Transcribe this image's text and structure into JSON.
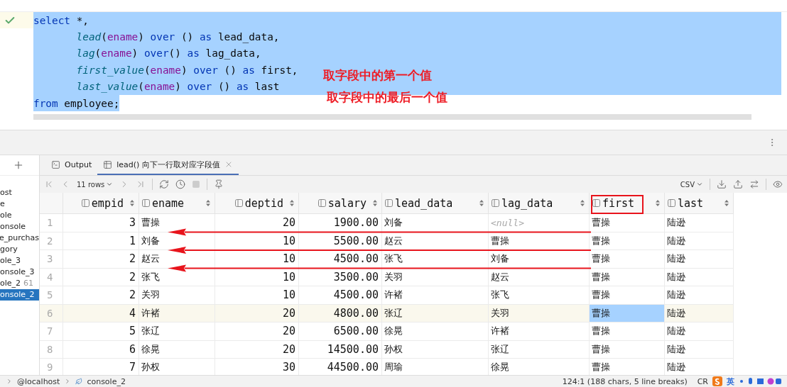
{
  "editor": {
    "executed": true,
    "lines": [
      {
        "selected": true,
        "indent": false,
        "tokens": [
          {
            "text": "select",
            "kind": "keyword"
          },
          {
            "text": " *,",
            "kind": "plain"
          }
        ]
      },
      {
        "selected": true,
        "indent": true,
        "tokens": [
          {
            "text": "lead",
            "kind": "function"
          },
          {
            "text": "(",
            "kind": "plain"
          },
          {
            "text": "ename",
            "kind": "field"
          },
          {
            "text": ") ",
            "kind": "plain"
          },
          {
            "text": "over",
            "kind": "keyword"
          },
          {
            "text": " () ",
            "kind": "plain"
          },
          {
            "text": "as",
            "kind": "keyword"
          },
          {
            "text": " lead_data,",
            "kind": "plain"
          }
        ]
      },
      {
        "selected": true,
        "indent": true,
        "tokens": [
          {
            "text": "lag",
            "kind": "function"
          },
          {
            "text": "(",
            "kind": "plain"
          },
          {
            "text": "ename",
            "kind": "field"
          },
          {
            "text": ") ",
            "kind": "plain"
          },
          {
            "text": "over",
            "kind": "keyword"
          },
          {
            "text": "() ",
            "kind": "plain"
          },
          {
            "text": "as",
            "kind": "keyword"
          },
          {
            "text": " lag_data,",
            "kind": "plain"
          }
        ]
      },
      {
        "selected": true,
        "indent": true,
        "tokens": [
          {
            "text": "first_value",
            "kind": "function"
          },
          {
            "text": "(",
            "kind": "plain"
          },
          {
            "text": "ename",
            "kind": "field"
          },
          {
            "text": ") ",
            "kind": "plain"
          },
          {
            "text": "over",
            "kind": "keyword"
          },
          {
            "text": " () ",
            "kind": "plain"
          },
          {
            "text": "as",
            "kind": "keyword"
          },
          {
            "text": " first,",
            "kind": "plain"
          }
        ]
      },
      {
        "selected": true,
        "indent": true,
        "tokens": [
          {
            "text": "last_value",
            "kind": "function"
          },
          {
            "text": "(",
            "kind": "plain"
          },
          {
            "text": "ename",
            "kind": "field"
          },
          {
            "text": ") ",
            "kind": "plain"
          },
          {
            "text": "over",
            "kind": "keyword"
          },
          {
            "text": " () ",
            "kind": "plain"
          },
          {
            "text": "as",
            "kind": "keyword"
          },
          {
            "text": " last",
            "kind": "plain"
          }
        ]
      },
      {
        "selected": true,
        "indent": false,
        "tokens": [
          {
            "text": "from",
            "kind": "keyword"
          },
          {
            "text": " employee;",
            "kind": "plain"
          }
        ]
      }
    ],
    "annotations": [
      "取字段中的第一个值",
      "取字段中的最后一个值"
    ]
  },
  "sidebar": {
    "items": [
      {
        "label": "ost",
        "selected": false
      },
      {
        "label": "e",
        "selected": false
      },
      {
        "label": "ole",
        "selected": false
      },
      {
        "label": "onsole",
        "selected": false
      },
      {
        "label": "e_purchas",
        "selected": false
      },
      {
        "label": "gory",
        "selected": false
      },
      {
        "label": "ole_3",
        "selected": false
      },
      {
        "label": "onsole_3",
        "selected": false
      },
      {
        "label": "ole_2",
        "count": "61",
        "selected": false
      },
      {
        "label": "onsole_2",
        "selected": true
      }
    ]
  },
  "tabs": [
    {
      "label": "Output",
      "kind": "output",
      "selected": false,
      "closable": false
    },
    {
      "label": "lead() 向下一行取对应字段值",
      "kind": "table",
      "selected": true,
      "closable": true
    }
  ],
  "toolbar": {
    "rows": "11 rows",
    "format": "CSV"
  },
  "table": {
    "columns": [
      {
        "name": "empid",
        "kind": "number",
        "highlighted": false
      },
      {
        "name": "ename",
        "kind": "text",
        "highlighted": false
      },
      {
        "name": "deptid",
        "kind": "number",
        "highlighted": false
      },
      {
        "name": "salary",
        "kind": "number",
        "highlighted": false
      },
      {
        "name": "lead_data",
        "kind": "text",
        "highlighted": false
      },
      {
        "name": "lag_data",
        "kind": "text",
        "highlighted": false
      },
      {
        "name": "first",
        "kind": "text",
        "highlighted": true
      },
      {
        "name": "last",
        "kind": "text",
        "highlighted": false
      }
    ],
    "rows": [
      {
        "num": "1",
        "selected": false,
        "cells": [
          "3",
          "曹操",
          "20",
          "1900.00",
          "刘备",
          {
            "text": "<null>",
            "kind": "null"
          },
          "曹操",
          "陆逊"
        ]
      },
      {
        "num": "2",
        "selected": false,
        "cells": [
          "1",
          "刘备",
          "10",
          "5500.00",
          "赵云",
          "曹操",
          "曹操",
          "陆逊"
        ]
      },
      {
        "num": "3",
        "selected": false,
        "cells": [
          "2",
          "赵云",
          "10",
          "4500.00",
          "张飞",
          "刘备",
          "曹操",
          "陆逊"
        ]
      },
      {
        "num": "4",
        "selected": false,
        "cells": [
          "2",
          "张飞",
          "10",
          "3500.00",
          "关羽",
          "赵云",
          "曹操",
          "陆逊"
        ]
      },
      {
        "num": "5",
        "selected": false,
        "cells": [
          "2",
          "关羽",
          "10",
          "4500.00",
          "许褚",
          "张飞",
          "曹操",
          "陆逊"
        ]
      },
      {
        "num": "6",
        "selected": true,
        "cells": [
          {
            "text": "4",
            "selected": false
          },
          {
            "text": "许褚",
            "selected": false
          },
          {
            "text": "20",
            "selected": false
          },
          {
            "text": "4800.00",
            "selected": false
          },
          {
            "text": "张辽",
            "selected": false
          },
          {
            "text": "关羽",
            "selected": false
          },
          {
            "text": "曹操",
            "selected": true
          },
          {
            "text": "陆逊",
            "selected": false
          }
        ]
      },
      {
        "num": "7",
        "selected": false,
        "cells": [
          "5",
          "张辽",
          "20",
          "6500.00",
          "徐晃",
          "许褚",
          "曹操",
          "陆逊"
        ]
      },
      {
        "num": "8",
        "selected": false,
        "cells": [
          "6",
          "徐晃",
          "20",
          "14500.00",
          "孙权",
          "张辽",
          "曹操",
          "陆逊"
        ]
      },
      {
        "num": "9",
        "selected": false,
        "cells": [
          "7",
          "孙权",
          "30",
          "44500.00",
          "周瑜",
          "徐晃",
          "曹操",
          "陆逊"
        ]
      }
    ]
  },
  "status_bar": {
    "breadcrumbs": [
      "@localhost",
      "console_2"
    ],
    "position": "124:1 (188 chars, 5 line breaks)",
    "line_ending": "CR",
    "ime": "英"
  }
}
